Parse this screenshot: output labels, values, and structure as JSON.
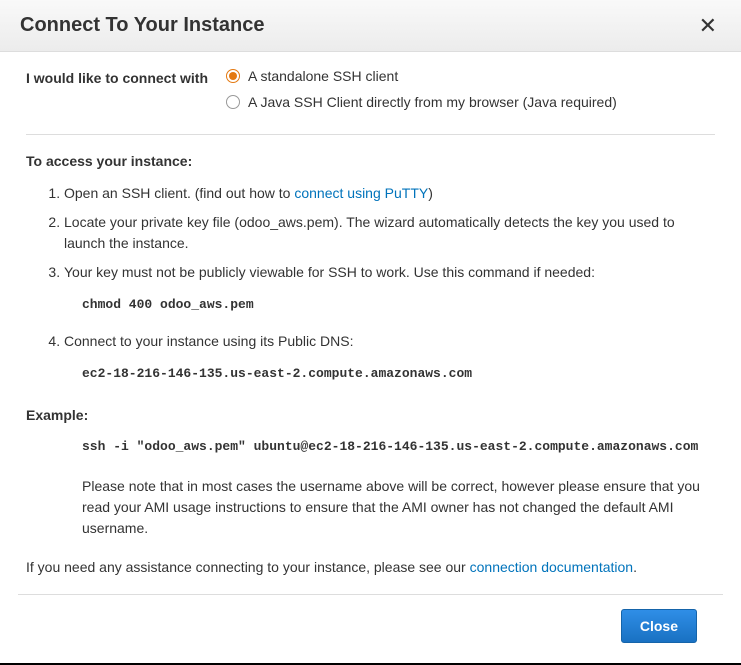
{
  "dialog": {
    "title": "Connect To Your Instance"
  },
  "connectWith": {
    "label": "I would like to connect with",
    "options": {
      "standalone": "A standalone SSH client",
      "java": "A Java SSH Client directly from my browser (Java required)"
    }
  },
  "access": {
    "title": "To access your instance:",
    "step1_prefix": "Open an SSH client. (find out how to ",
    "step1_link": "connect using PuTTY",
    "step1_suffix": ")",
    "step2": "Locate your private key file (odoo_aws.pem). The wizard automatically detects the key you used to launch the instance.",
    "step3": "Your key must not be publicly viewable for SSH to work. Use this command if needed:",
    "step3_code": "chmod 400 odoo_aws.pem",
    "step4": "Connect to your instance using its Public DNS:",
    "step4_code": "ec2-18-216-146-135.us-east-2.compute.amazonaws.com"
  },
  "example": {
    "label": "Example:",
    "code": "ssh -i \"odoo_aws.pem\" ubuntu@ec2-18-216-146-135.us-east-2.compute.amazonaws.com",
    "note": "Please note that in most cases the username above will be correct, however please ensure that you read your AMI usage instructions to ensure that the AMI owner has not changed the default AMI username."
  },
  "assistance": {
    "prefix": "If you need any assistance connecting to your instance, please see our ",
    "link": "connection documentation",
    "suffix": "."
  },
  "footer": {
    "close": "Close"
  }
}
